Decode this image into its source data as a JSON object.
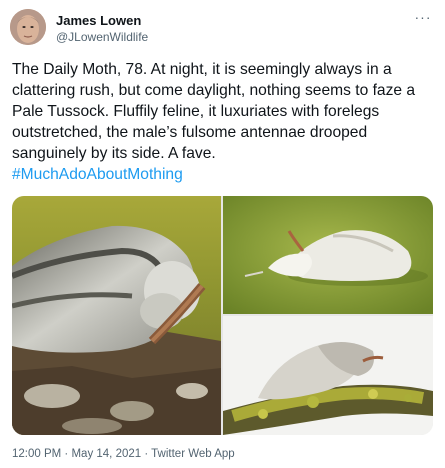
{
  "author": {
    "name": "James Lowen",
    "handle": "@JLowenWildlife"
  },
  "more_icon": "more-horizontal-icon",
  "tweet": {
    "text": "The Daily Moth, 78. At night, it is seemingly always in a clattering rush, but come daylight, nothing seems to faze a Pale Tussock. Fluffily feline, it luxuriates with forelegs outstretched, the male’s fulsome antennae drooped sanguinely by its side. A fave.",
    "hashtag": "#MuchAdoAboutMothing"
  },
  "footer": {
    "time": "12:00 PM",
    "separator": " · ",
    "date": "May 14, 2021",
    "source": "Twitter Web App"
  },
  "colors": {
    "link": "#1d9bf0",
    "secondary_text": "#536471"
  }
}
